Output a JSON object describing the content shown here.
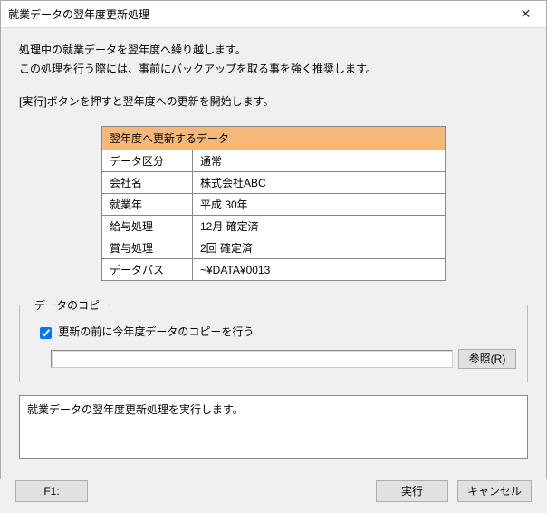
{
  "window": {
    "title": "就業データの翌年度更新処理"
  },
  "messages": {
    "line1": "処理中の就業データを翌年度へ繰り越します。",
    "line2": "この処理を行う際には、事前にバックアップを取る事を強く推奨します。",
    "line3": "[実行]ボタンを押すと翌年度への更新を開始します。"
  },
  "table": {
    "header": "翌年度へ更新するデータ",
    "rows": [
      {
        "label": "データ区分",
        "value": "通常"
      },
      {
        "label": "会社名",
        "value": "株式会社ABC"
      },
      {
        "label": "就業年",
        "value": "平成 30年"
      },
      {
        "label": "給与処理",
        "value": " 12月 確定済"
      },
      {
        "label": "賞与処理",
        "value": "  2回 確定済"
      },
      {
        "label": "データパス",
        "value": "~¥DATA¥0013"
      }
    ]
  },
  "copy": {
    "legend": "データのコピー",
    "checkbox_label": "更新の前に今年度データのコピーを行う",
    "checked": true,
    "path": "",
    "browse_label": "参照(R)"
  },
  "status": {
    "text": "就業データの翌年度更新処理を実行します。"
  },
  "buttons": {
    "f1": "F1:",
    "execute": "実行",
    "cancel": "キャンセル"
  }
}
